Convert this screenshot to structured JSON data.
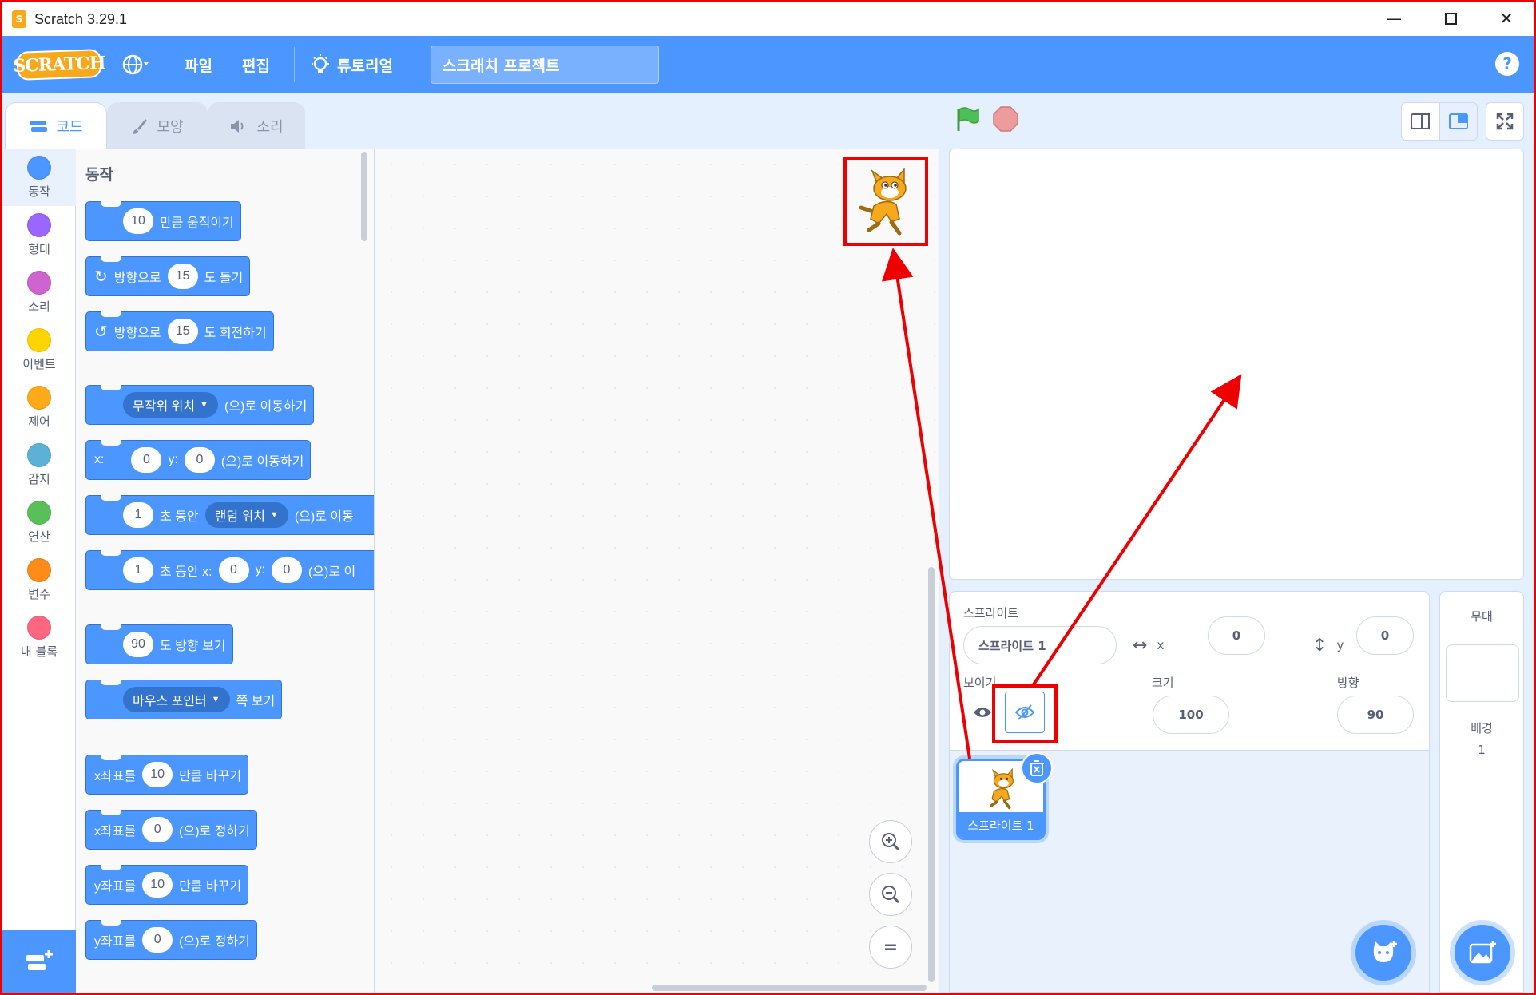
{
  "window": {
    "title": "Scratch 3.29.1",
    "app_icon_glyph": "S"
  },
  "menubar": {
    "logo_text": "SCRATCH",
    "file": "파일",
    "edit": "편집",
    "tutorials": "튜토리얼",
    "project_title": "스크래치 프로젝트",
    "help": "?"
  },
  "tabs": [
    {
      "label": "코드",
      "icon": "code-icon"
    },
    {
      "label": "모양",
      "icon": "brush-icon"
    },
    {
      "label": "소리",
      "icon": "speaker-icon"
    }
  ],
  "categories": [
    {
      "label": "동작",
      "color": "#4c97ff"
    },
    {
      "label": "형태",
      "color": "#9966ff"
    },
    {
      "label": "소리",
      "color": "#cf63cf"
    },
    {
      "label": "이벤트",
      "color": "#ffd500"
    },
    {
      "label": "제어",
      "color": "#ffab19"
    },
    {
      "label": "감지",
      "color": "#5cb1d6"
    },
    {
      "label": "연산",
      "color": "#59c059"
    },
    {
      "label": "변수",
      "color": "#ff8c1a"
    },
    {
      "label": "내 블록",
      "color": "#ff6680"
    }
  ],
  "palette": {
    "section": "동작",
    "blocks": {
      "move": {
        "v": "10",
        "t": "만큼 움직이기"
      },
      "turn_right": {
        "a": "방향으로",
        "v": "15",
        "b": "도 돌기"
      },
      "turn_left": {
        "a": "방향으로",
        "v": "15",
        "b": "도 회전하기"
      },
      "goto": {
        "dd": "무작위 위치",
        "t": "(으)로 이동하기"
      },
      "gotoxy": {
        "x": "x:",
        "xv": "0",
        "y": "y:",
        "yv": "0",
        "t": "(으)로 이동하기"
      },
      "glide": {
        "v": "1",
        "a": "초 동안",
        "dd": "랜덤 위치",
        "t": "(으)로 이동"
      },
      "glidexy": {
        "v": "1",
        "a": "초 동안 x:",
        "xv": "0",
        "y": "y:",
        "yv": "0",
        "t": "(으)로 이"
      },
      "point": {
        "v": "90",
        "t": "도 방향 보기"
      },
      "pointto": {
        "dd": "마우스 포인터",
        "t": "쪽 보기"
      },
      "changex": {
        "a": "x좌표를",
        "v": "10",
        "t": "만큼 바꾸기"
      },
      "setx": {
        "a": "x좌표를",
        "v": "0",
        "t": "(으)로 정하기"
      },
      "changey": {
        "a": "y좌표를",
        "v": "10",
        "t": "만큼 바꾸기"
      },
      "sety": {
        "a": "y좌표를",
        "v": "0",
        "t": "(으)로 정하기"
      }
    }
  },
  "code_area": {
    "zoom_in": "+",
    "zoom_out": "−",
    "zoom_reset": "="
  },
  "sprite_info": {
    "sprite_label": "스프라이트",
    "sprite_name": "스프라이트 1",
    "x_label": "x",
    "x_value": "0",
    "y_label": "y",
    "y_value": "0",
    "show_label": "보이기",
    "size_label": "크기",
    "size_value": "100",
    "direction_label": "방향",
    "direction_value": "90"
  },
  "sprite_list": [
    {
      "name": "스프라이트 1"
    }
  ],
  "stage_pane": {
    "title": "무대",
    "backdrops_label": "배경",
    "backdrops_count": "1"
  },
  "colors": {
    "accent": "#4c97ff",
    "annotation": "#ee0000"
  }
}
